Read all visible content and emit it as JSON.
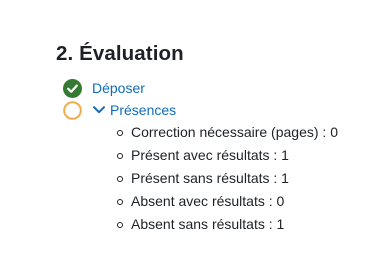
{
  "section": {
    "title": "2. Évaluation"
  },
  "activities": [
    {
      "label": "Déposer",
      "status": "complete",
      "icon": "check-circle-icon",
      "status_color": "#357a32"
    },
    {
      "label": "Présences",
      "status": "incomplete",
      "icon": "empty-circle-icon",
      "status_color": "#f0ad4e",
      "expanded": true,
      "items": [
        "Correction nécessaire (pages) : 0",
        "Présent avec résultats : 1",
        "Présent sans résultats : 1",
        "Absent avec résultats : 0",
        "Absent sans résultats : 1"
      ]
    }
  ],
  "colors": {
    "link": "#0f6cbf",
    "text": "#1d2125"
  }
}
